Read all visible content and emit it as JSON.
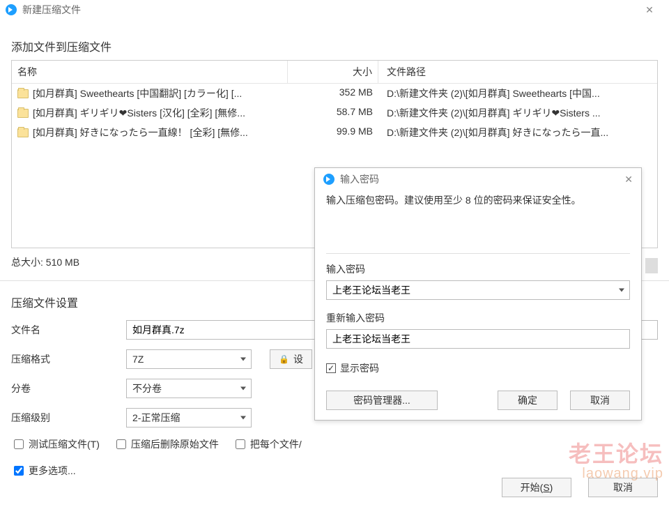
{
  "window": {
    "title": "新建压缩文件"
  },
  "add_section": {
    "heading": "添加文件到压缩文件",
    "columns": {
      "name": "名称",
      "size": "大小",
      "path": "文件路径"
    },
    "rows": [
      {
        "name": "[如月群真] Sweethearts [中国翻訳] [カラー化] [...",
        "size": "352 MB",
        "path": "D:\\新建文件夹 (2)\\[如月群真] Sweethearts [中国..."
      },
      {
        "name": "[如月群真] ギリギリ❤Sisters [汉化] [全彩] [無修...",
        "size": "58.7 MB",
        "path": "D:\\新建文件夹 (2)\\[如月群真] ギリギリ❤Sisters ..."
      },
      {
        "name": "[如月群真] 好きになったら一直線！ [全彩] [無修...",
        "size": "99.9 MB",
        "path": "D:\\新建文件夹 (2)\\[如月群真] 好きになったら一直..."
      }
    ],
    "total": "总大小: 510 MB"
  },
  "settings": {
    "heading": "压缩文件设置",
    "labels": {
      "filename": "文件名",
      "format": "压缩格式",
      "split": "分卷",
      "level": "压缩级别"
    },
    "values": {
      "filename": "如月群真.7z",
      "format": "7Z",
      "split": "不分卷",
      "level": "2-正常压缩"
    },
    "set_password_button": "设",
    "checks": {
      "test": "测试压缩文件(T)",
      "delete_after": "压缩后删除原始文件",
      "per_file": "把每个文件/"
    },
    "more_options": "更多选项..."
  },
  "buttons": {
    "open_hotkey": "S",
    "open_prefix": "开",
    "open_suffix": "始(",
    "open_close": ")",
    "cancel": "取消"
  },
  "dialog": {
    "title": "输入密码",
    "message": "输入压缩包密码。建议使用至少 8 位的密码来保证安全性。",
    "label_enter": "输入密码",
    "label_reenter": "重新输入密码",
    "password": "上老王论坛当老王",
    "password2": "上老王论坛当老王",
    "show_password": "显示密码",
    "manager": "密码管理器...",
    "ok": "确定",
    "cancel": "取消"
  },
  "watermark": {
    "big": "老王论坛",
    "small": "laowang.vip"
  }
}
